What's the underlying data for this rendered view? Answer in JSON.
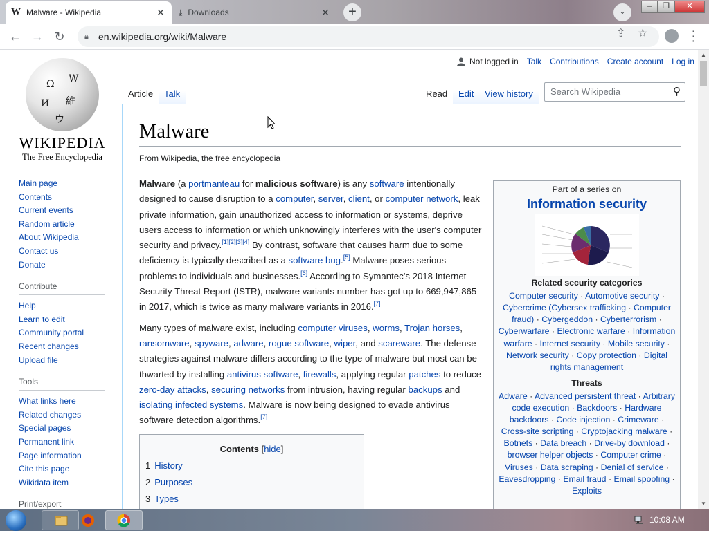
{
  "browser": {
    "tabs": [
      {
        "favicon": "W",
        "title": "Malware - Wikipedia",
        "close": "✕"
      },
      {
        "favicon": "⤓",
        "title": "Downloads",
        "close": "✕"
      }
    ],
    "new_tab": "+",
    "tab_search": "⌄",
    "window_controls": {
      "minimize": "–",
      "restore": "❐",
      "close": "✕"
    },
    "url": "en.wikipedia.org/wiki/Malware"
  },
  "wiki": {
    "wordmark": "WIKIPEDIA",
    "tagline": "The Free Encyclopedia",
    "personal": {
      "not_logged_in": "Not logged in",
      "talk": "Talk",
      "contributions": "Contributions",
      "create_account": "Create account",
      "log_in": "Log in"
    },
    "tabs": {
      "article": "Article",
      "talk": "Talk",
      "read": "Read",
      "edit": "Edit",
      "view_history": "View history"
    },
    "search_placeholder": "Search Wikipedia",
    "sidebar": {
      "main": [
        "Main page",
        "Contents",
        "Current events",
        "Random article",
        "About Wikipedia",
        "Contact us",
        "Donate"
      ],
      "contribute_heading": "Contribute",
      "contribute": [
        "Help",
        "Learn to edit",
        "Community portal",
        "Recent changes",
        "Upload file"
      ],
      "tools_heading": "Tools",
      "tools": [
        "What links here",
        "Related changes",
        "Special pages",
        "Permanent link",
        "Page information",
        "Cite this page",
        "Wikidata item"
      ],
      "print_heading": "Print/export"
    },
    "title": "Malware",
    "from": "From Wikipedia, the free encyclopedia",
    "toc": {
      "title": "Contents",
      "hide": "hide",
      "items": [
        {
          "num": "1",
          "label": "History"
        },
        {
          "num": "2",
          "label": "Purposes"
        },
        {
          "num": "3",
          "label": "Types"
        }
      ]
    },
    "infobox": {
      "part_of": "Part of a series on",
      "title": "Information security",
      "related_heading": "Related security categories",
      "related": [
        "Computer security",
        "Automotive security",
        "Cybercrime (Cybersex trafficking",
        "Computer fraud)",
        "Cybergeddon",
        "Cyberterrorism",
        "Cyberwarfare",
        "Electronic warfare",
        "Information warfare",
        "Internet security",
        "Mobile security",
        "Network security",
        "Copy protection",
        "Digital rights management"
      ],
      "threats_heading": "Threats",
      "threats": [
        "Adware",
        "Advanced persistent threat",
        "Arbitrary code execution",
        "Backdoors",
        "Hardware backdoors",
        "Code injection",
        "Crimeware",
        "Cross-site scripting",
        "Cryptojacking malware",
        "Botnets",
        "Data breach",
        "Drive-by download",
        "browser helper objects",
        "Computer crime",
        "Viruses",
        "Data scraping",
        "Denial of service",
        "Eavesdropping",
        "Email fraud",
        "Email spoofing",
        "Exploits"
      ]
    }
  },
  "taskbar": {
    "clock": "10:08 AM"
  }
}
